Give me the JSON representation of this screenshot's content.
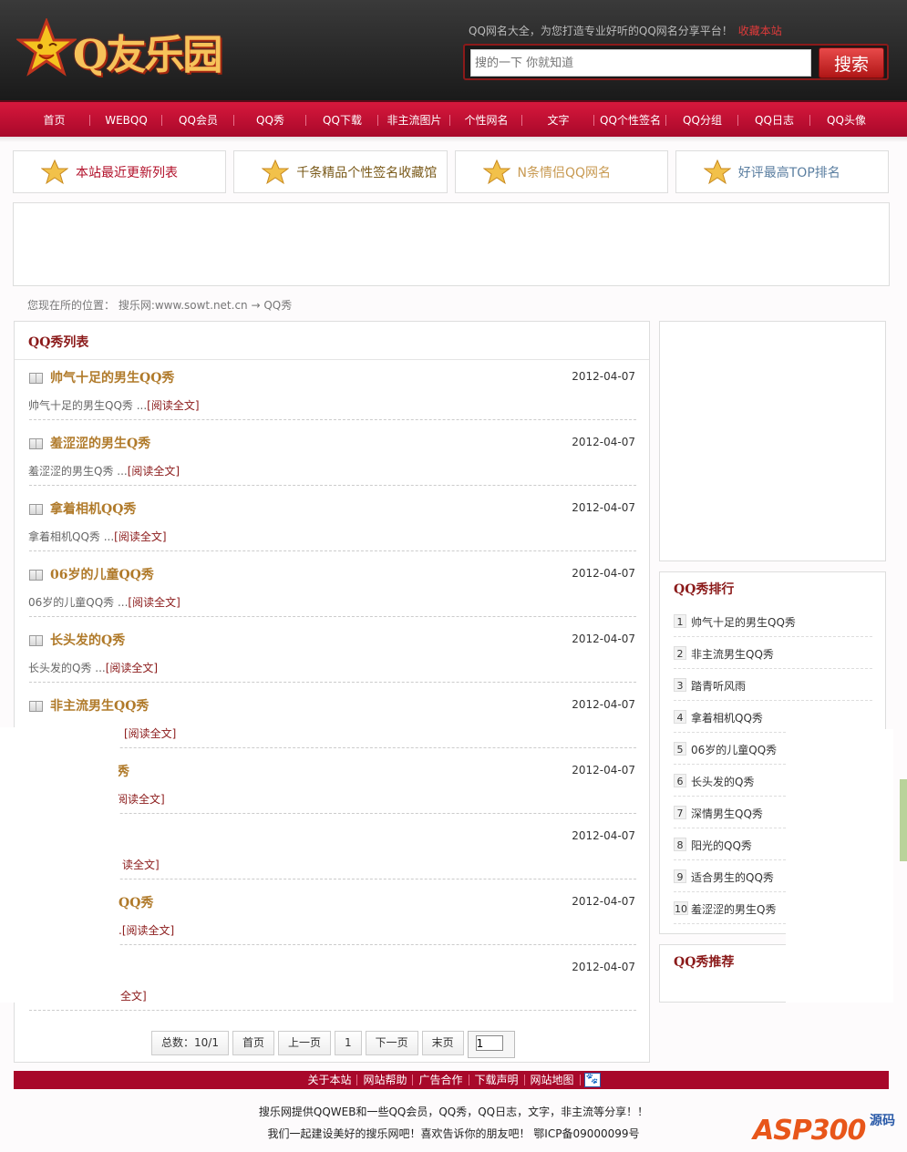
{
  "logo": {
    "text": "Q友乐园"
  },
  "header": {
    "slogan": "QQ网名大全，为您打造专业好听的QQ网名分享平台！",
    "bookmark": "收藏本站",
    "search_placeholder": "搜的一下 你就知道",
    "search_button": "搜索"
  },
  "nav": [
    "首页",
    "WEBQQ",
    "QQ会员",
    "QQ秀",
    "QQ下载",
    "非主流图片",
    "个性网名",
    "文字",
    "QQ个性签名",
    "QQ分组",
    "QQ日志",
    "QQ头像"
  ],
  "features": [
    "本站最近更新列表",
    "千条精品个性签名收藏馆",
    "N条情侣QQ网名",
    "好评最高TOP排名"
  ],
  "breadcrumb": "您现在所的位置： 搜乐网:www.sowt.net.cn → QQ秀",
  "main": {
    "title": "QQ秀列表",
    "more_label": "[阅读全文]",
    "entries": [
      {
        "title": "帅气十足的男生QQ秀",
        "date": "2012-04-07",
        "desc": "帅气十足的男生QQ秀 ..."
      },
      {
        "title": "羞涩涩的男生Q秀",
        "date": "2012-04-07",
        "desc": "羞涩涩的男生Q秀 ..."
      },
      {
        "title": "拿着相机QQ秀",
        "date": "2012-04-07",
        "desc": "拿着相机QQ秀 ..."
      },
      {
        "title": "06岁的儿童QQ秀",
        "date": "2012-04-07",
        "desc": "06岁的儿童QQ秀 ..."
      },
      {
        "title": "长头发的Q秀",
        "date": "2012-04-07",
        "desc": "长头发的Q秀 ..."
      },
      {
        "title": "非主流男生QQ秀",
        "date": "2012-04-07",
        "desc": ""
      },
      {
        "title": "",
        "date": "2012-04-07",
        "desc": ""
      },
      {
        "title": "",
        "date": "2012-04-07",
        "desc": ""
      },
      {
        "title": "",
        "date": "2012-04-07",
        "desc": ""
      },
      {
        "title": "",
        "date": "2012-04-07",
        "desc": ""
      }
    ]
  },
  "pager": {
    "total": "总数：10/1",
    "first": "首页",
    "prev": "上一页",
    "page": "1",
    "next": "下一页",
    "last": "末页",
    "jump_value": "1"
  },
  "sidebar": {
    "rank_title": "QQ秀排行",
    "rank": [
      {
        "num": "1",
        "text": "帅气十足的男生QQ秀"
      },
      {
        "num": "2",
        "text": "非主流男生QQ秀"
      },
      {
        "num": "3",
        "text": "踏青听风雨"
      },
      {
        "num": "4",
        "text": "拿着相机QQ秀"
      },
      {
        "num": "5",
        "text": "06岁的儿童QQ秀"
      },
      {
        "num": "6",
        "text": "长头发的Q秀"
      },
      {
        "num": "7",
        "text": "深情男生QQ秀"
      },
      {
        "num": "8",
        "text": "阳光的QQ秀"
      },
      {
        "num": "9",
        "text": "适合男生的QQ秀"
      },
      {
        "num": "10",
        "text": "羞涩涩的男生Q秀"
      }
    ],
    "rec_title": "QQ秀推荐"
  },
  "footer": {
    "links": [
      "关于本站",
      "网站帮助",
      "广告合作",
      "下载声明",
      "网站地图"
    ],
    "line1": "搜乐网提供QQWEB和一些QQ会员，QQ秀，QQ日志，文字，非主流等分享！！",
    "line2": "我们一起建设美好的搜乐网吧！喜欢告诉你的朋友吧！ 鄂ICP备09000099号"
  },
  "watermark": {
    "text": "ASP300",
    "sub": "源码"
  },
  "colors": {
    "nav": "#a8082a",
    "accent": "#8b1a1a",
    "entry_title": "#b07a2a"
  }
}
